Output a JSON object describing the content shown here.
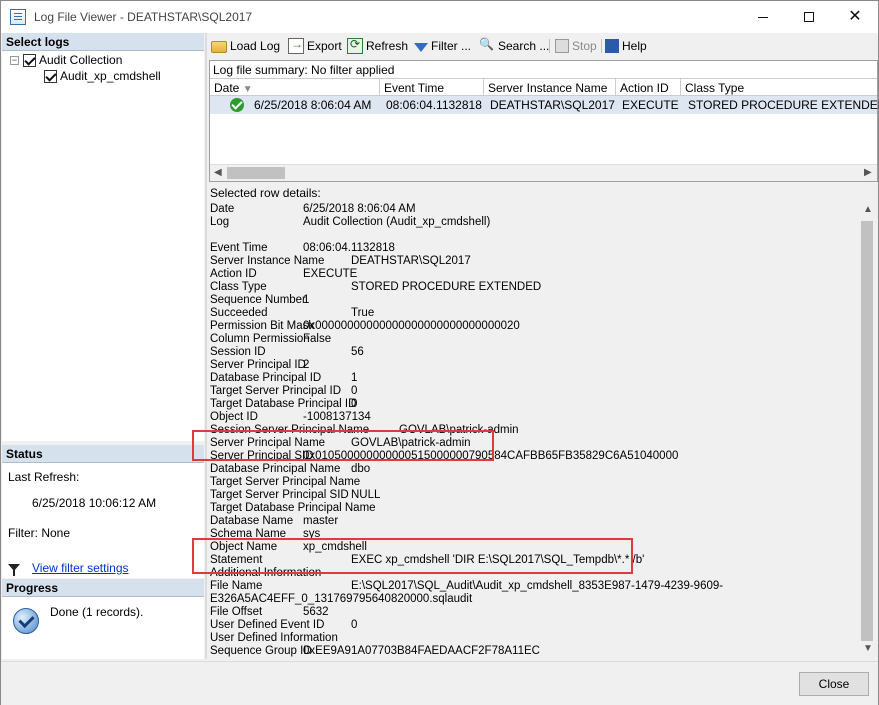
{
  "window": {
    "title": "Log File Viewer - DEATHSTAR\\SQL2017"
  },
  "left": {
    "select_logs_title": "Select logs",
    "tree": [
      {
        "label": "Audit Collection"
      },
      {
        "label": "Audit_xp_cmdshell"
      }
    ],
    "status_title": "Status",
    "last_refresh_label": "Last Refresh:",
    "last_refresh_value": "6/25/2018 10:06:12 AM",
    "filter_label": "Filter: None",
    "view_filter_link": "View filter settings",
    "progress_title": "Progress",
    "progress_text": "Done (1 records)."
  },
  "toolbar": {
    "load_log": "Load Log",
    "export": "Export",
    "refresh": "Refresh",
    "filter": "Filter ...",
    "search": "Search ...",
    "stop": "Stop",
    "help": "Help"
  },
  "grid": {
    "summary": "Log file summary: No filter applied",
    "columns": [
      "Date",
      "Event Time",
      "Server Instance Name",
      "Action ID",
      "Class Type"
    ],
    "row": [
      "6/25/2018 8:06:04 AM",
      "08:06:04.1132818",
      "DEATHSTAR\\SQL2017",
      "EXECUTE",
      "STORED PROCEDURE EXTENDED"
    ]
  },
  "details": {
    "header": "Selected row details:",
    "rows": [
      {
        "label": "Date",
        "value": "6/25/2018 8:06:04 AM"
      },
      {
        "label": "Log",
        "value": "Audit Collection (Audit_xp_cmdshell)"
      },
      {
        "label": "",
        "value": ""
      },
      {
        "label": "Event Time",
        "value": "08:06:04.1132818"
      },
      {
        "label": "Server Instance Name",
        "value": "DEATHSTAR\\SQL2017"
      },
      {
        "label": "Action ID",
        "value": "EXECUTE"
      },
      {
        "label": "Class Type",
        "value": "STORED PROCEDURE EXTENDED"
      },
      {
        "label": "Sequence Number",
        "value": "1"
      },
      {
        "label": "Succeeded",
        "value": "True"
      },
      {
        "label": "Permission Bit Mask",
        "value": "0x00000000000000000000000000000020"
      },
      {
        "label": "Column Permission",
        "value": "False"
      },
      {
        "label": "Session ID",
        "value": "56"
      },
      {
        "label": "Server Principal ID",
        "value": "2"
      },
      {
        "label": "Database Principal ID",
        "value": "1"
      },
      {
        "label": "Target Server Principal ID",
        "value": "0"
      },
      {
        "label": "Target Database Principal ID",
        "value": "0"
      },
      {
        "label": "Object ID",
        "value": "-1008137134"
      },
      {
        "label": "Session Server Principal Name",
        "value": "GOVLAB\\patrick-admin"
      },
      {
        "label": "Server Principal Name",
        "value": "GOVLAB\\patrick-admin"
      },
      {
        "label": "Server Principal SID",
        "value": "0x010500000000000515000000790584CAFBB65FB35829C6A51040000"
      },
      {
        "label": "Database Principal Name",
        "value": "dbo"
      },
      {
        "label": "Target Server Principal Name",
        "value": ""
      },
      {
        "label": "Target Server Principal SID",
        "value": "NULL"
      },
      {
        "label": "Target Database Principal Name",
        "value": ""
      },
      {
        "label": "Database Name",
        "value": "master"
      },
      {
        "label": "Schema Name",
        "value": "sys"
      },
      {
        "label": "Object Name",
        "value": "xp_cmdshell"
      },
      {
        "label": "Statement",
        "value": "EXEC xp_cmdshell 'DIR E:\\SQL2017\\SQL_Tempdb\\*.* /b'"
      },
      {
        "label": "Additional Information",
        "value": ""
      },
      {
        "label": "File Name",
        "value": "E:\\SQL2017\\SQL_Audit\\Audit_xp_cmdshell_8353E987-1479-4239-9609-"
      },
      {
        "label": "",
        "value": "E326A5AC4EFF_0_131769795640820000.sqlaudit"
      },
      {
        "label": "File Offset",
        "value": "5632"
      },
      {
        "label": "User Defined Event ID",
        "value": "0"
      },
      {
        "label": "User Defined Information",
        "value": ""
      },
      {
        "label": "Sequence Group ID",
        "value": "0xEE9A91A07703B84FAEDAACF2F78A11EC"
      }
    ]
  },
  "footer": {
    "close_label": "Close"
  },
  "colors": {
    "highlight": "#e0393e",
    "selected_row": "#dde6f1",
    "panel_header": "#d6e1ee",
    "link": "#0033cc"
  }
}
